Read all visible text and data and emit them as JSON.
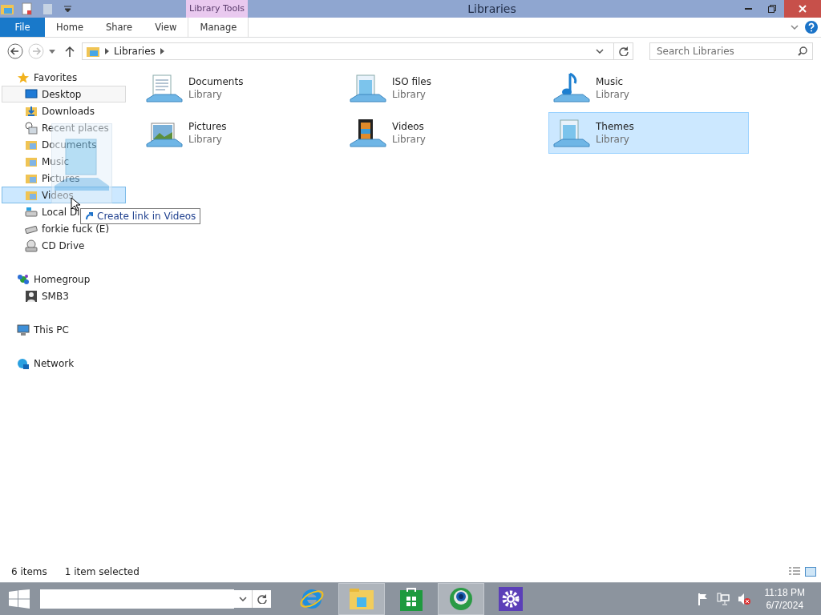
{
  "window": {
    "title": "Libraries",
    "context_tab_group": "Library Tools"
  },
  "ribbon_tabs": [
    {
      "label": "File",
      "kind": "file"
    },
    {
      "label": "Home",
      "kind": "tab"
    },
    {
      "label": "Share",
      "kind": "tab"
    },
    {
      "label": "View",
      "kind": "tab"
    },
    {
      "label": "Manage",
      "kind": "contextual"
    }
  ],
  "address": {
    "path": [
      "Libraries"
    ],
    "search_placeholder": "Search Libraries"
  },
  "navigation": [
    {
      "label": "Favorites",
      "kind": "star",
      "children": [
        {
          "label": "Desktop",
          "kind": "desktop",
          "focused": true,
          "selected": false
        },
        {
          "label": "Downloads",
          "kind": "downloads",
          "focused": false,
          "selected": false
        },
        {
          "label": "Recent places",
          "kind": "recent",
          "focused": false,
          "selected": false
        },
        {
          "label": "Documents",
          "kind": "folder",
          "focused": false,
          "selected": false
        },
        {
          "label": "Music",
          "kind": "folder",
          "focused": false,
          "selected": false
        },
        {
          "label": "Pictures",
          "kind": "folder",
          "focused": false,
          "selected": false
        },
        {
          "label": "Videos",
          "kind": "folder",
          "focused": false,
          "selected": true
        },
        {
          "label": "Local Di",
          "kind": "disk",
          "focused": false,
          "selected": false
        },
        {
          "label": "forkie fuck (E)",
          "kind": "drive",
          "focused": false,
          "selected": false
        },
        {
          "label": "CD Drive",
          "kind": "cd",
          "focused": false,
          "selected": false
        }
      ]
    },
    {
      "label": "Homegroup",
      "kind": "homegroup",
      "children": [
        {
          "label": "SMB3",
          "kind": "user",
          "focused": false,
          "selected": false
        }
      ]
    },
    {
      "label": "This PC",
      "kind": "pc"
    },
    {
      "label": "Network",
      "kind": "network"
    }
  ],
  "libraries": [
    {
      "name": "Documents",
      "type": "Library",
      "kind": "documents",
      "selected": false
    },
    {
      "name": "ISO files",
      "type": "Library",
      "kind": "generic",
      "selected": false
    },
    {
      "name": "Music",
      "type": "Library",
      "kind": "music",
      "selected": false
    },
    {
      "name": "Pictures",
      "type": "Library",
      "kind": "pictures",
      "selected": false
    },
    {
      "name": "Videos",
      "type": "Library",
      "kind": "videos",
      "selected": false
    },
    {
      "name": "Themes",
      "type": "Library",
      "kind": "generic",
      "selected": true
    }
  ],
  "drag_tooltip": "Create link in Videos",
  "status_bar": {
    "item_count": "6 items",
    "selection": "1 item selected"
  },
  "taskbar": {
    "apps": [
      {
        "kind": "ie",
        "active": false
      },
      {
        "kind": "explorer",
        "active": true
      },
      {
        "kind": "store",
        "active": false
      },
      {
        "kind": "globe",
        "active": true
      },
      {
        "kind": "settings",
        "active": false
      }
    ],
    "time": "11:18 PM",
    "date": "6/7/2024"
  }
}
